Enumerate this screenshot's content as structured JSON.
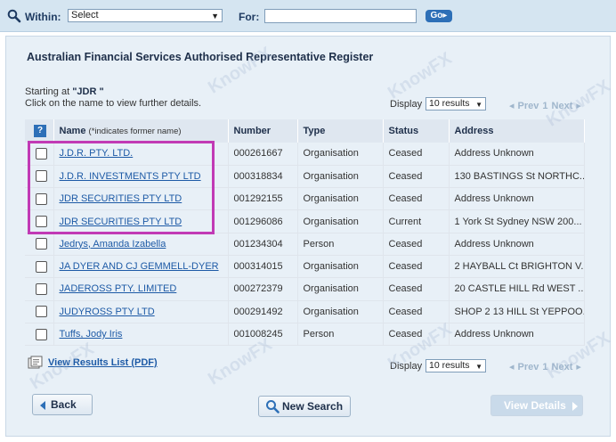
{
  "search": {
    "within_label": "Within:",
    "within_value": "Select",
    "for_label": "For:",
    "for_value": "",
    "go_label": "Go"
  },
  "page": {
    "title": "Australian Financial Services Authorised Representative Register",
    "starting_prefix": "Starting at",
    "starting_value": "\"JDR \"",
    "click_hint": "Click on the name to view further details."
  },
  "pager": {
    "display_label": "Display",
    "display_value": "10 results",
    "prev_label": "Prev",
    "page_number": "1",
    "next_label": "Next"
  },
  "table": {
    "headers": {
      "select": "?",
      "name": "Name",
      "name_note": "(*indicates former name)",
      "number": "Number",
      "type": "Type",
      "status": "Status",
      "address": "Address"
    },
    "rows": [
      {
        "name": "J.D.R. PTY. LTD.",
        "number": "000261667",
        "type": "Organisation",
        "status": "Ceased",
        "address": "Address Unknown"
      },
      {
        "name": "J.D.R. INVESTMENTS PTY LTD",
        "number": "000318834",
        "type": "Organisation",
        "status": "Ceased",
        "address": "130 BASTINGS St NORTHC..."
      },
      {
        "name": "JDR SECURITIES PTY LTD",
        "number": "001292155",
        "type": "Organisation",
        "status": "Ceased",
        "address": "Address Unknown"
      },
      {
        "name": "JDR SECURITIES PTY LTD",
        "number": "001296086",
        "type": "Organisation",
        "status": "Current",
        "address": "1 York St Sydney NSW 200..."
      },
      {
        "name": "Jedrys, Amanda Izabella",
        "number": "001234304",
        "type": "Person",
        "status": "Ceased",
        "address": "Address Unknown"
      },
      {
        "name": "JA DYER AND CJ GEMMELL-DYER",
        "number": "000314015",
        "type": "Organisation",
        "status": "Ceased",
        "address": "2 HAYBALL Ct BRIGHTON V..."
      },
      {
        "name": "JADEROSS PTY. LIMITED",
        "number": "000272379",
        "type": "Organisation",
        "status": "Ceased",
        "address": "20 CASTLE HILL Rd WEST ..."
      },
      {
        "name": "JUDYROSS PTY LTD",
        "number": "000291492",
        "type": "Organisation",
        "status": "Ceased",
        "address": "SHOP 2 13 HILL St YEPPOO..."
      },
      {
        "name": "Tuffs, Jody Iris",
        "number": "001008245",
        "type": "Person",
        "status": "Ceased",
        "address": "Address Unknown"
      }
    ]
  },
  "footer": {
    "pdf_link": "View Results List (PDF)",
    "back_label": "Back",
    "new_search_label": "New Search",
    "view_details_label": "View Details"
  },
  "watermark": "KnowFX",
  "colors": {
    "accent": "#2d6fb7",
    "highlight": "#c13ab5",
    "link": "#1d5aa6",
    "header_bg": "#d5e5f1"
  }
}
